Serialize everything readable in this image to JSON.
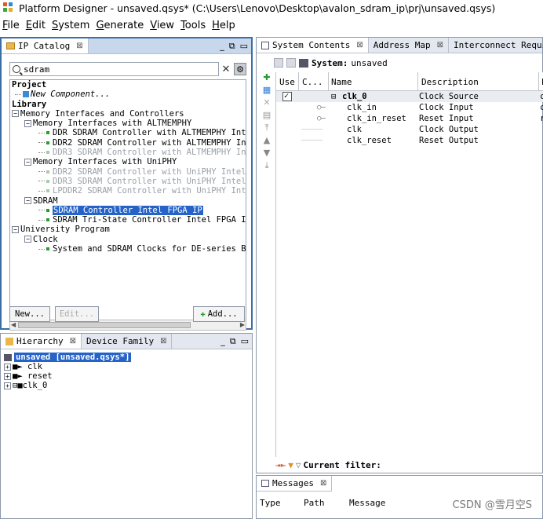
{
  "window": {
    "title": "Platform Designer - unsaved.qsys* (C:\\Users\\Lenovo\\Desktop\\avalon_sdram_ip\\prj\\unsaved.qsys)"
  },
  "menu": {
    "items": [
      {
        "label": "File",
        "key": "F",
        "rest": "ile"
      },
      {
        "label": "Edit",
        "key": "E",
        "rest": "dit"
      },
      {
        "label": "System",
        "key": "S",
        "rest": "ystem"
      },
      {
        "label": "Generate",
        "key": "G",
        "rest": "enerate"
      },
      {
        "label": "View",
        "key": "V",
        "rest": "iew"
      },
      {
        "label": "Tools",
        "key": "T",
        "rest": "ools"
      },
      {
        "label": "Help",
        "key": "H",
        "rest": "elp"
      }
    ]
  },
  "ip_catalog": {
    "tab_label": "IP Catalog",
    "search_value": "sdram",
    "tree": {
      "project": "Project",
      "new_component": "New Component...",
      "library": "Library",
      "mem_interfaces": "Memory Interfaces and Controllers",
      "altmemphy_group": "Memory Interfaces with ALTMEMPHY",
      "altmemphy_items": [
        "DDR SDRAM Controller with ALTMEMPHY Int",
        "DDR2 SDRAM Controller with ALTMEMPHY In",
        "DDR3 SDRAM Controller with ALTMEMPHY In"
      ],
      "uniphy_group": "Memory Interfaces with UniPHY",
      "uniphy_items": [
        "DDR2 SDRAM Controller with UniPHY Intel",
        "DDR3 SDRAM Controller with UniPHY Intel",
        "LPDDR2 SDRAM Controller with UniPHY Int"
      ],
      "sdram_group": "SDRAM",
      "sdram_items": [
        "SDRAM Controller Intel FPGA IP",
        "SDRAM Tri-State Controller Intel FPGA I"
      ],
      "university": "University Program",
      "clock": "Clock",
      "clock_item": "System and SDRAM Clocks for DE-series B"
    },
    "buttons": {
      "new": "New...",
      "edit": "Edit...",
      "add": "Add..."
    }
  },
  "hierarchy": {
    "tabs": [
      "Hierarchy",
      "Device Family"
    ],
    "root": "unsaved [unsaved.qsys*]",
    "items": [
      "clk",
      "reset",
      "clk_0"
    ]
  },
  "system_contents": {
    "tabs": [
      "System Contents",
      "Address Map",
      "Interconnect Requir"
    ],
    "system_label": "System:",
    "system_name": "unsaved",
    "columns": [
      "Use",
      "C...",
      "Name",
      "Description",
      "E"
    ],
    "rows": [
      {
        "name": "clk_0",
        "description": "Clock Source",
        "extra": "c"
      },
      {
        "name": "clk_in",
        "description": "Clock Input",
        "extra": "c"
      },
      {
        "name": "clk_in_reset",
        "description": "Reset Input",
        "extra": "r"
      },
      {
        "name": "clk",
        "description": "Clock Output",
        "extra": ""
      },
      {
        "name": "clk_reset",
        "description": "Reset Output",
        "extra": ""
      }
    ],
    "filter_label": "Current filter:"
  },
  "messages": {
    "tab_label": "Messages",
    "columns": [
      "Type",
      "Path",
      "Message"
    ]
  },
  "watermark": "CSDN @雪月空S",
  "colors": {
    "selection": "#2563c8",
    "active_border": "#3a6ea5",
    "tab_bar": "#e3e8f0",
    "green_dot": "#2a9a2a"
  }
}
